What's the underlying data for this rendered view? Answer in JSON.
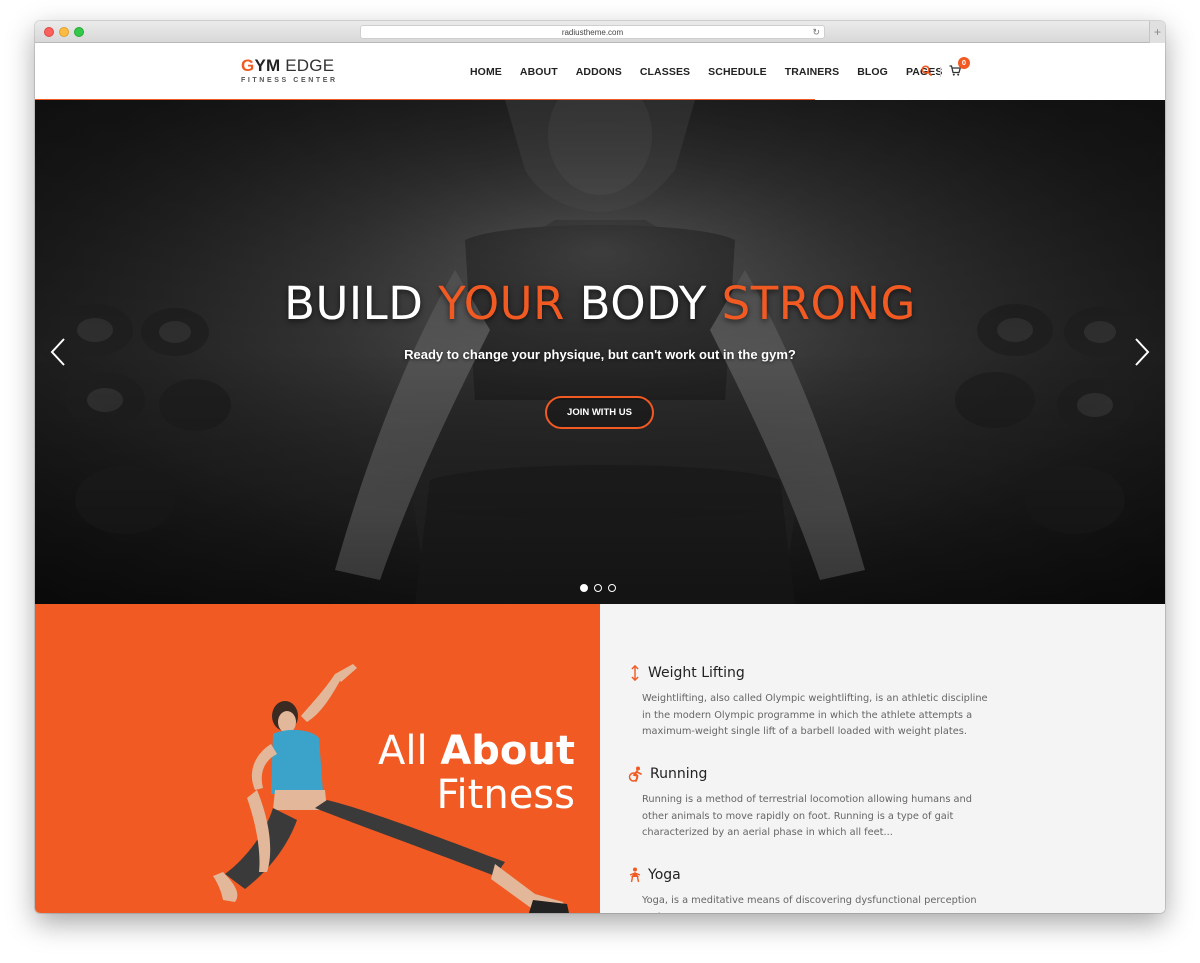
{
  "browser": {
    "url": "radiustheme.com",
    "reload_glyph": "↻",
    "new_tab_glyph": "+"
  },
  "logo": {
    "gym_first": "G",
    "gym_rest": "YM",
    "edge": " EDGE",
    "subtitle": "FITNESS CENTER"
  },
  "nav": {
    "items": [
      "HOME",
      "ABOUT",
      "ADDONS",
      "CLASSES",
      "SCHEDULE",
      "TRAINERS",
      "BLOG",
      "PAGES"
    ],
    "cart_count": "0"
  },
  "hero": {
    "title_parts": [
      "BUILD ",
      "YOUR",
      " BODY ",
      "STRONG"
    ],
    "subtitle": "Ready to change your physique, but can't work out in the gym?",
    "button_label": "JOIN WITH US",
    "active_slide": 1,
    "slide_count": 3
  },
  "features": {
    "heading_light": "All ",
    "heading_bold": "About",
    "heading_line2": "Fitness",
    "items": [
      {
        "title": "Weight Lifting",
        "icon": "weight-lifting-icon",
        "desc": "Weightlifting, also called Olympic weightlifting, is an athletic discipline in the modern Olympic programme in which the athlete attempts a maximum-weight single lift of a barbell loaded with weight plates."
      },
      {
        "title": "Running",
        "icon": "running-icon",
        "desc": "Running is a method of terrestrial locomotion allowing humans and other animals to move rapidly on foot. Running is a type of gait characterized by an aerial phase in which all feet..."
      },
      {
        "title": "Yoga",
        "icon": "yoga-icon",
        "desc": "Yoga, is a meditative means of discovering dysfunctional perception and"
      }
    ]
  },
  "colors": {
    "accent": "#f15a22",
    "text_dark": "#222222",
    "section_bg": "#f4f4f4"
  }
}
